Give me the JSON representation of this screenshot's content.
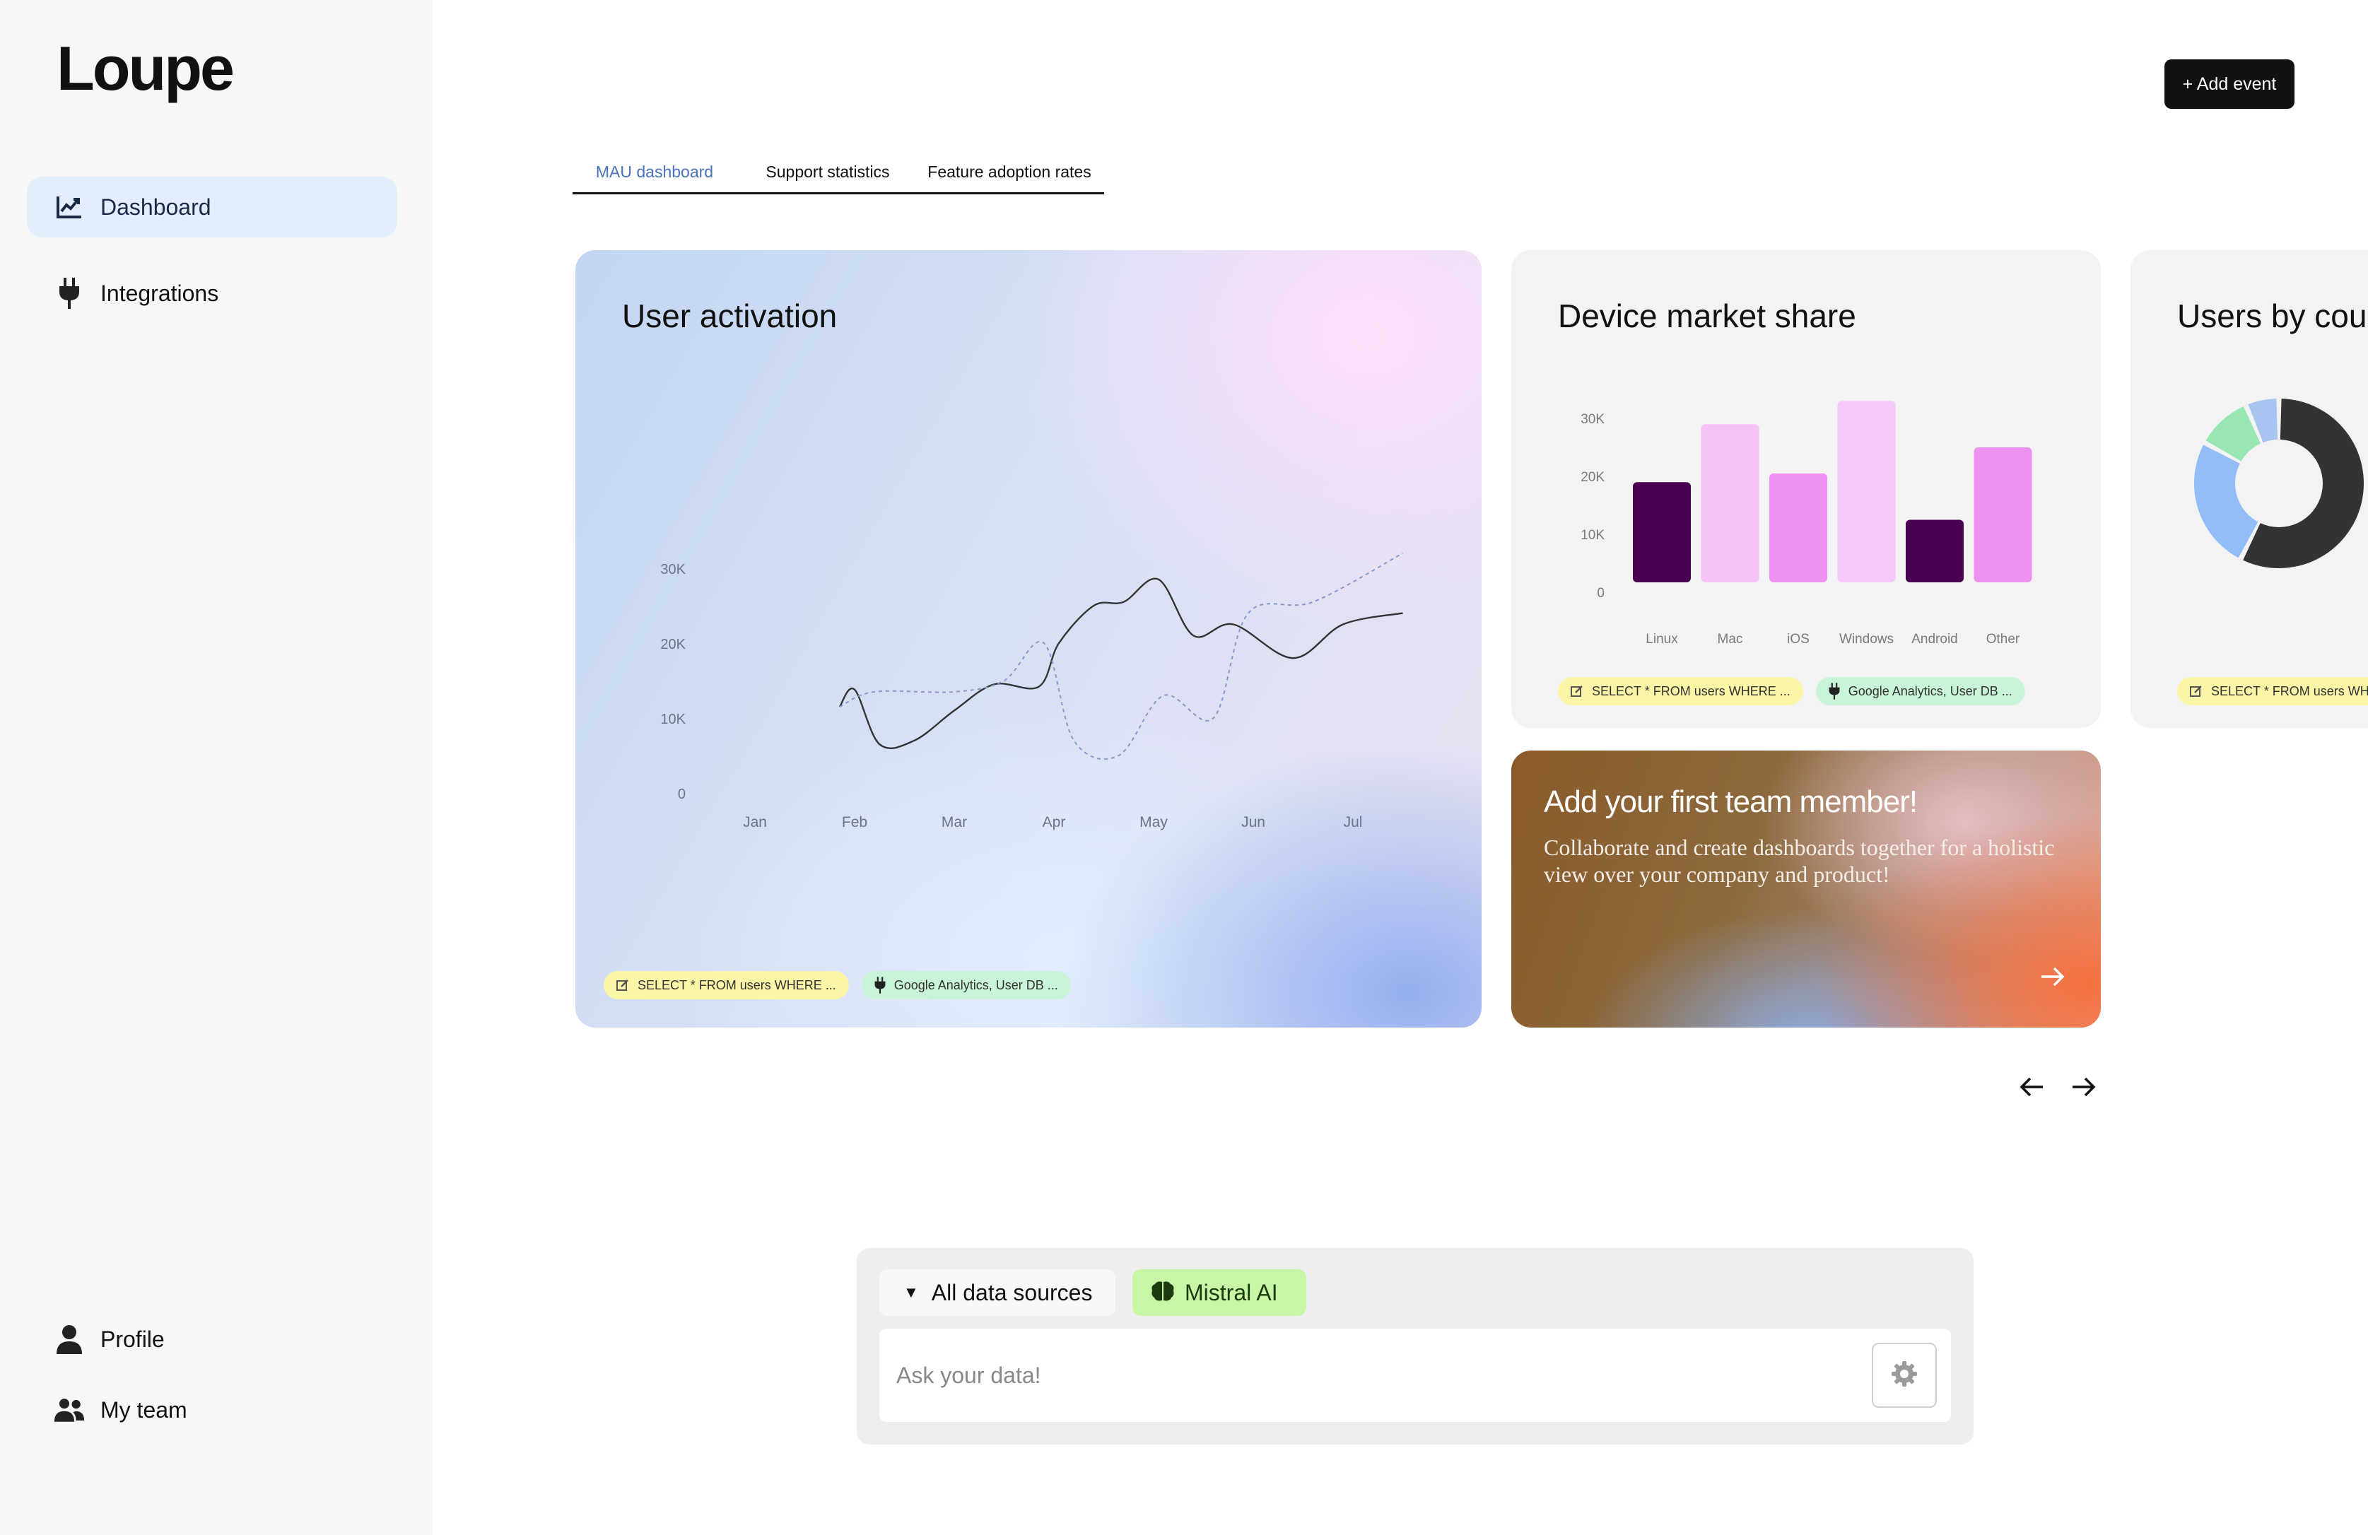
{
  "app": {
    "logo": "Loupe"
  },
  "sidebar": {
    "items": [
      {
        "label": "Dashboard",
        "icon": "chart-line-icon",
        "active": true
      },
      {
        "label": "Integrations",
        "icon": "plug-icon",
        "active": false
      }
    ],
    "bottom_items": [
      {
        "label": "Profile",
        "icon": "user-icon"
      },
      {
        "label": "My team",
        "icon": "users-icon"
      }
    ]
  },
  "header": {
    "add_event_label": "+ Add event"
  },
  "tabs": [
    {
      "label": "MAU dashboard",
      "active": true
    },
    {
      "label": "Support statistics",
      "active": false
    },
    {
      "label": "Feature adoption rates",
      "active": false
    }
  ],
  "cards": {
    "activation": {
      "title": "User activation",
      "chips": {
        "sql": "SELECT * FROM users WHERE ...",
        "sources": "Google Analytics, User DB ..."
      }
    },
    "device": {
      "title": "Device market share",
      "chips": {
        "sql": "SELECT * FROM users WHERE ...",
        "sources": "Google Analytics, User DB ..."
      }
    },
    "users": {
      "title": "Users by cou",
      "chips": {
        "sql": "SELECT * FROM users WH"
      }
    },
    "team": {
      "title": "Add your first team member!",
      "subtitle": "Collaborate and create dashboards together for a holistic view over your company and product!"
    }
  },
  "ask": {
    "data_sources_label": "All data sources",
    "model_label": "Mistral AI",
    "placeholder": "Ask your data!"
  },
  "colors": {
    "accent": "#e3eefd",
    "tab_active": "#4b73b8",
    "chip_sql": "#fbf5a8",
    "chip_source": "#c9f4d8",
    "ai_button": "#c8f6a6"
  },
  "chart_data": [
    {
      "type": "line",
      "title": "User activation",
      "xlabel": "",
      "ylabel": "",
      "x": [
        "Jan",
        "Feb",
        "Mar",
        "Apr",
        "May",
        "Jun",
        "Jul"
      ],
      "y_ticks": [
        "0",
        "10K",
        "20K",
        "30K"
      ],
      "ylim": [
        0,
        30000
      ],
      "grid": false,
      "series": [
        {
          "style": "solid",
          "color": "#333333",
          "points": [
            [
              0.85,
              11500
            ],
            [
              1.0,
              13800
            ],
            [
              1.25,
              6500
            ],
            [
              1.6,
              7000
            ],
            [
              2.0,
              11000
            ],
            [
              2.4,
              14500
            ],
            [
              2.85,
              14200
            ],
            [
              3.05,
              20000
            ],
            [
              3.4,
              25000
            ],
            [
              3.7,
              25500
            ],
            [
              4.05,
              28500
            ],
            [
              4.4,
              21000
            ],
            [
              4.8,
              22500
            ],
            [
              5.4,
              18000
            ],
            [
              5.9,
              22500
            ],
            [
              6.5,
              24000
            ]
          ]
        },
        {
          "style": "dashed",
          "color": "#8a9acc",
          "points": [
            [
              0.85,
              11500
            ],
            [
              1.2,
              13500
            ],
            [
              2.0,
              13500
            ],
            [
              2.5,
              15000
            ],
            [
              2.9,
              20000
            ],
            [
              3.2,
              7000
            ],
            [
              3.65,
              5000
            ],
            [
              4.1,
              13000
            ],
            [
              4.6,
              10000
            ],
            [
              4.95,
              24000
            ],
            [
              5.6,
              25500
            ],
            [
              6.5,
              32000
            ]
          ]
        }
      ]
    },
    {
      "type": "bar",
      "title": "Device market share",
      "categories": [
        "Linux",
        "Mac",
        "iOS",
        "Windows",
        "Android",
        "Other"
      ],
      "values": [
        19000,
        29000,
        20500,
        33000,
        12500,
        25000
      ],
      "colors": [
        "#4a0050",
        "#f6c2f7",
        "#ee92f2",
        "#f7c6fa",
        "#4a0050",
        "#ee92f2"
      ],
      "y_ticks": [
        "0",
        "10K",
        "20K",
        "30K"
      ],
      "ylim": [
        0,
        33000
      ]
    },
    {
      "type": "pie",
      "title": "Users by cou",
      "values": [
        54,
        24,
        10,
        6
      ],
      "colors": [
        "#333333",
        "#93bdf7",
        "#98e6b4",
        "#a8c4f0"
      ]
    }
  ]
}
